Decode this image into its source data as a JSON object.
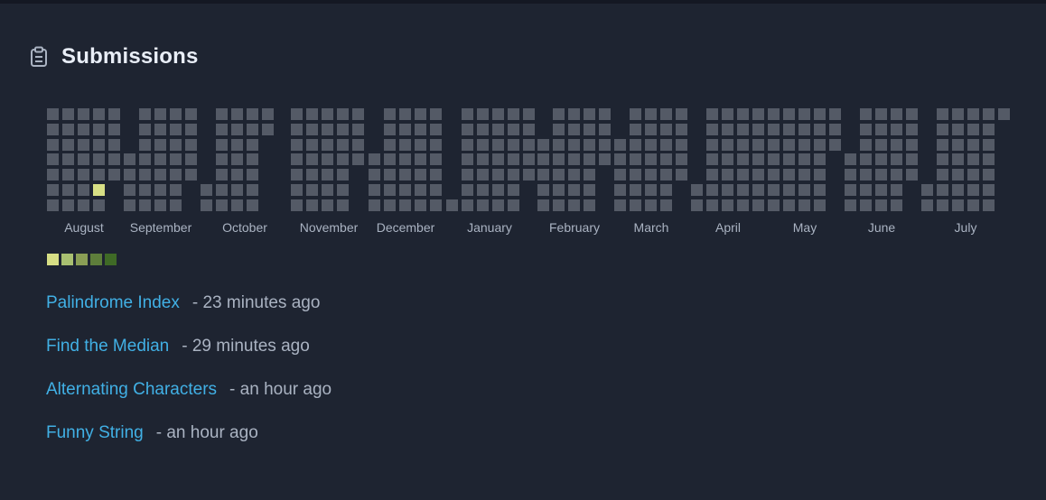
{
  "header": {
    "title": "Submissions",
    "icon": "clipboard-icon"
  },
  "activity_calendar": {
    "months": [
      "August",
      "September",
      "October",
      "November",
      "December",
      "January",
      "February",
      "March",
      "April",
      "May",
      "June",
      "July"
    ],
    "empty_color": "#545a66",
    "active_cells": [
      {
        "month": "August",
        "week": 3,
        "day": 5,
        "level": 1
      }
    ],
    "legend_colors": [
      "#d7df85",
      "#a9c071",
      "#8a9e55",
      "#5e7e3b",
      "#3f6a26"
    ]
  },
  "submissions": [
    {
      "title": "Palindrome Index",
      "time": "- 23 minutes ago"
    },
    {
      "title": "Find the Median",
      "time": "- 29 minutes ago"
    },
    {
      "title": "Alternating Characters",
      "time": "- an hour ago"
    },
    {
      "title": "Funny String",
      "time": "- an hour ago"
    }
  ],
  "colors": {
    "link": "#41b0e5",
    "muted": "#aab3c2",
    "background": "#1e2431"
  }
}
